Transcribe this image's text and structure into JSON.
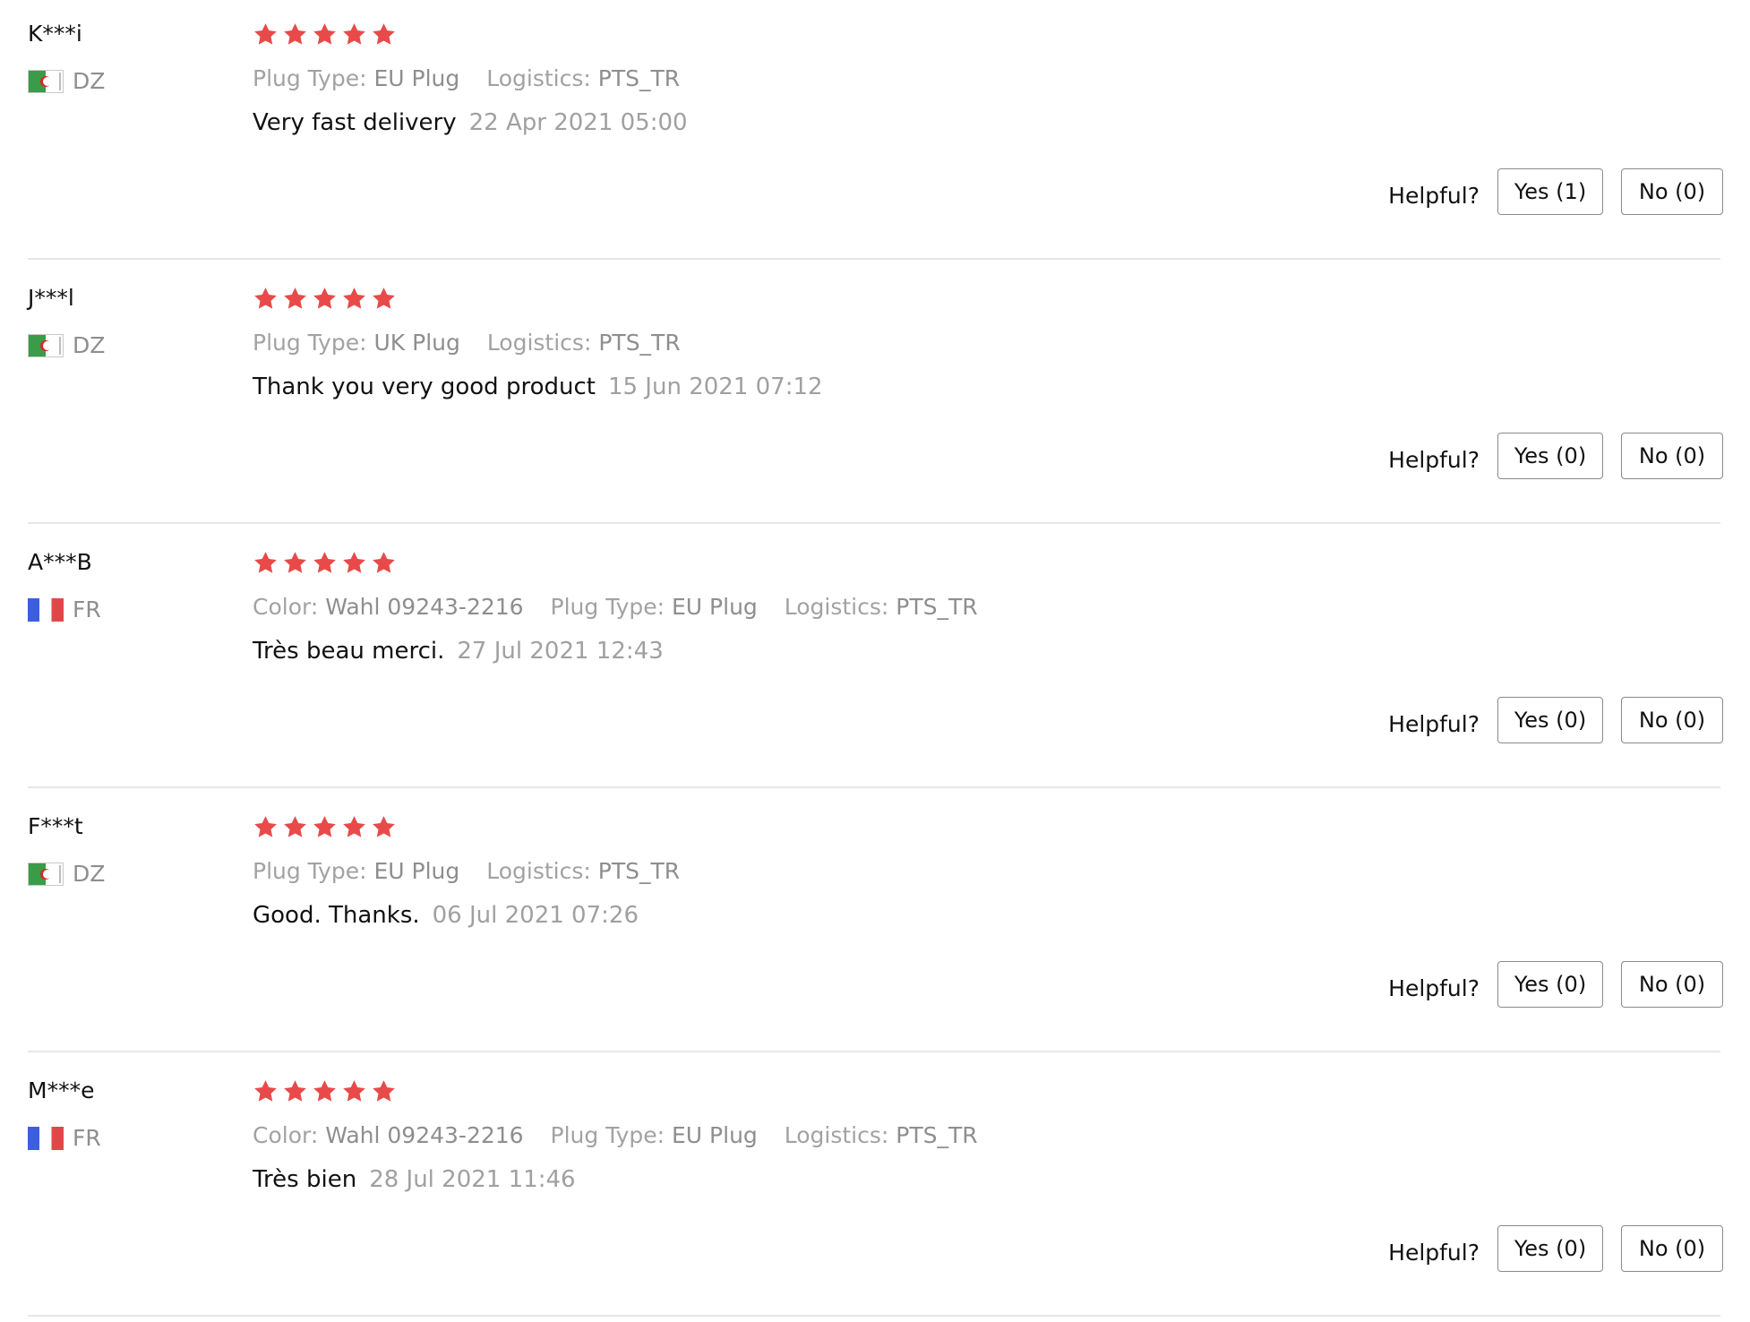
{
  "helpful_label": "Helpful?",
  "star_color": "#e84a4a",
  "reviews": [
    {
      "username": "K***i",
      "country": "DZ",
      "flag": "flag-algeria",
      "rating": 5,
      "attributes": [
        {
          "key": "Plug Type:",
          "value": "EU Plug"
        },
        {
          "key": "Logistics:",
          "value": "PTS_TR"
        }
      ],
      "feedback": "Very fast delivery",
      "date": "22 Apr 2021 05:00",
      "yes_label": "Yes (1)",
      "no_label": "No (0)"
    },
    {
      "username": "J***l",
      "country": "DZ",
      "flag": "flag-algeria",
      "rating": 5,
      "attributes": [
        {
          "key": "Plug Type:",
          "value": "UK Plug"
        },
        {
          "key": "Logistics:",
          "value": "PTS_TR"
        }
      ],
      "feedback": "Thank you very good product",
      "date": "15 Jun 2021 07:12",
      "yes_label": "Yes (0)",
      "no_label": "No (0)"
    },
    {
      "username": "A***B",
      "country": "FR",
      "flag": "flag-france",
      "rating": 5,
      "attributes": [
        {
          "key": "Color:",
          "value": "Wahl 09243-2216"
        },
        {
          "key": "Plug Type:",
          "value": "EU Plug"
        },
        {
          "key": "Logistics:",
          "value": "PTS_TR"
        }
      ],
      "feedback": "Très beau merci.",
      "date": "27 Jul 2021 12:43",
      "yes_label": "Yes (0)",
      "no_label": "No (0)"
    },
    {
      "username": "F***t",
      "country": "DZ",
      "flag": "flag-algeria",
      "rating": 5,
      "attributes": [
        {
          "key": "Plug Type:",
          "value": "EU Plug"
        },
        {
          "key": "Logistics:",
          "value": "PTS_TR"
        }
      ],
      "feedback": "Good. Thanks.",
      "date": "06 Jul 2021 07:26",
      "yes_label": "Yes (0)",
      "no_label": "No (0)"
    },
    {
      "username": "M***e",
      "country": "FR",
      "flag": "flag-france",
      "rating": 5,
      "attributes": [
        {
          "key": "Color:",
          "value": "Wahl 09243-2216"
        },
        {
          "key": "Plug Type:",
          "value": "EU Plug"
        },
        {
          "key": "Logistics:",
          "value": "PTS_TR"
        }
      ],
      "feedback": "Très bien",
      "date": "28 Jul 2021 11:46",
      "yes_label": "Yes (0)",
      "no_label": "No (0)"
    }
  ]
}
